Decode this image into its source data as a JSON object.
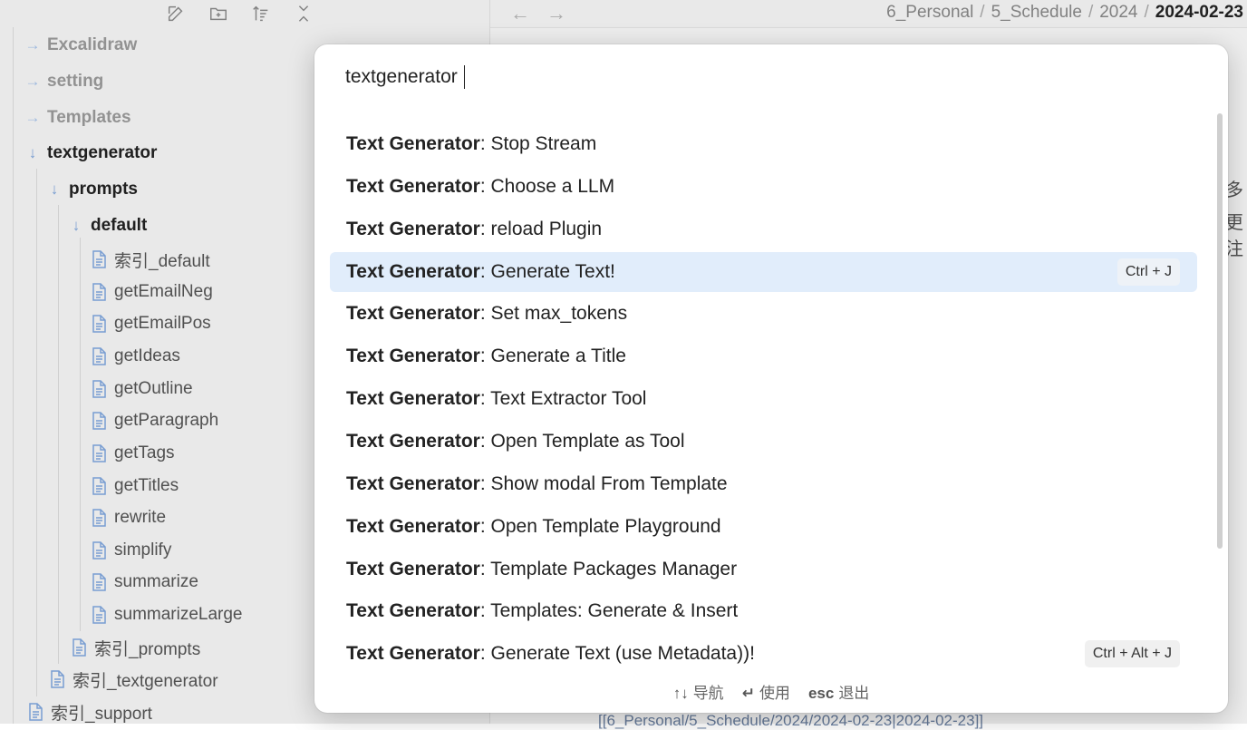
{
  "sidebar": {
    "toolbar": [
      "new-note-icon",
      "new-folder-icon",
      "sort-icon",
      "collapse-all-icon"
    ],
    "tree": [
      {
        "label": "Excalidraw",
        "type": "folder",
        "state": "collapsed",
        "depth": 0,
        "dim": true
      },
      {
        "label": "setting",
        "type": "folder",
        "state": "collapsed",
        "depth": 0,
        "dim": true
      },
      {
        "label": "Templates",
        "type": "folder",
        "state": "collapsed",
        "depth": 0,
        "dim": true
      },
      {
        "label": "textgenerator",
        "type": "folder",
        "state": "expanded",
        "depth": 0
      },
      {
        "label": "prompts",
        "type": "folder",
        "state": "expanded",
        "depth": 1
      },
      {
        "label": "default",
        "type": "folder",
        "state": "expanded",
        "depth": 2
      },
      {
        "label": "索引_default",
        "type": "file",
        "depth": 3
      },
      {
        "label": "getEmailNeg",
        "type": "file",
        "depth": 3
      },
      {
        "label": "getEmailPos",
        "type": "file",
        "depth": 3
      },
      {
        "label": "getIdeas",
        "type": "file",
        "depth": 3
      },
      {
        "label": "getOutline",
        "type": "file",
        "depth": 3
      },
      {
        "label": "getParagraph",
        "type": "file",
        "depth": 3
      },
      {
        "label": "getTags",
        "type": "file",
        "depth": 3
      },
      {
        "label": "getTitles",
        "type": "file",
        "depth": 3
      },
      {
        "label": "rewrite",
        "type": "file",
        "depth": 3
      },
      {
        "label": "simplify",
        "type": "file",
        "depth": 3
      },
      {
        "label": "summarize",
        "type": "file",
        "depth": 3
      },
      {
        "label": "summarizeLarge",
        "type": "file",
        "depth": 3
      },
      {
        "label": "索引_prompts",
        "type": "file",
        "depth": 2
      },
      {
        "label": "索引_textgenerator",
        "type": "file",
        "depth": 1
      },
      {
        "label": "索引_support",
        "type": "file",
        "depth": 0
      }
    ]
  },
  "topbar": {
    "back": "←",
    "forward": "→",
    "breadcrumbs": [
      "6_Personal",
      "5_Schedule",
      "2024"
    ],
    "current": "2024-02-23"
  },
  "editor": {
    "cjk_fragments": [
      "多",
      "更注"
    ],
    "link_fragment": "[[6_Personal/5_Schedule/2024/2024-02-23|2024-02-23]]"
  },
  "palette": {
    "query": "textgenerator",
    "plugin": "Text Generator",
    "items": [
      {
        "command": "Stop Stream",
        "hotkey": ""
      },
      {
        "command": "Choose a LLM",
        "hotkey": ""
      },
      {
        "command": "reload Plugin",
        "hotkey": ""
      },
      {
        "command": "Generate Text!",
        "hotkey": "Ctrl + J",
        "selected": true
      },
      {
        "command": "Set max_tokens",
        "hotkey": ""
      },
      {
        "command": "Generate a Title",
        "hotkey": ""
      },
      {
        "command": "Text Extractor Tool",
        "hotkey": ""
      },
      {
        "command": "Open Template as Tool",
        "hotkey": ""
      },
      {
        "command": "Show modal From Template",
        "hotkey": ""
      },
      {
        "command": "Open Template Playground",
        "hotkey": ""
      },
      {
        "command": "Template Packages Manager",
        "hotkey": ""
      },
      {
        "command": "Templates: Generate & Insert",
        "hotkey": ""
      },
      {
        "command": "Generate Text (use Metadata))!",
        "hotkey": "Ctrl + Alt + J"
      }
    ],
    "footer": [
      {
        "key": "↑↓",
        "label": "导航"
      },
      {
        "key": "↵",
        "label": "使用"
      },
      {
        "key": "esc",
        "label": "退出"
      }
    ]
  }
}
